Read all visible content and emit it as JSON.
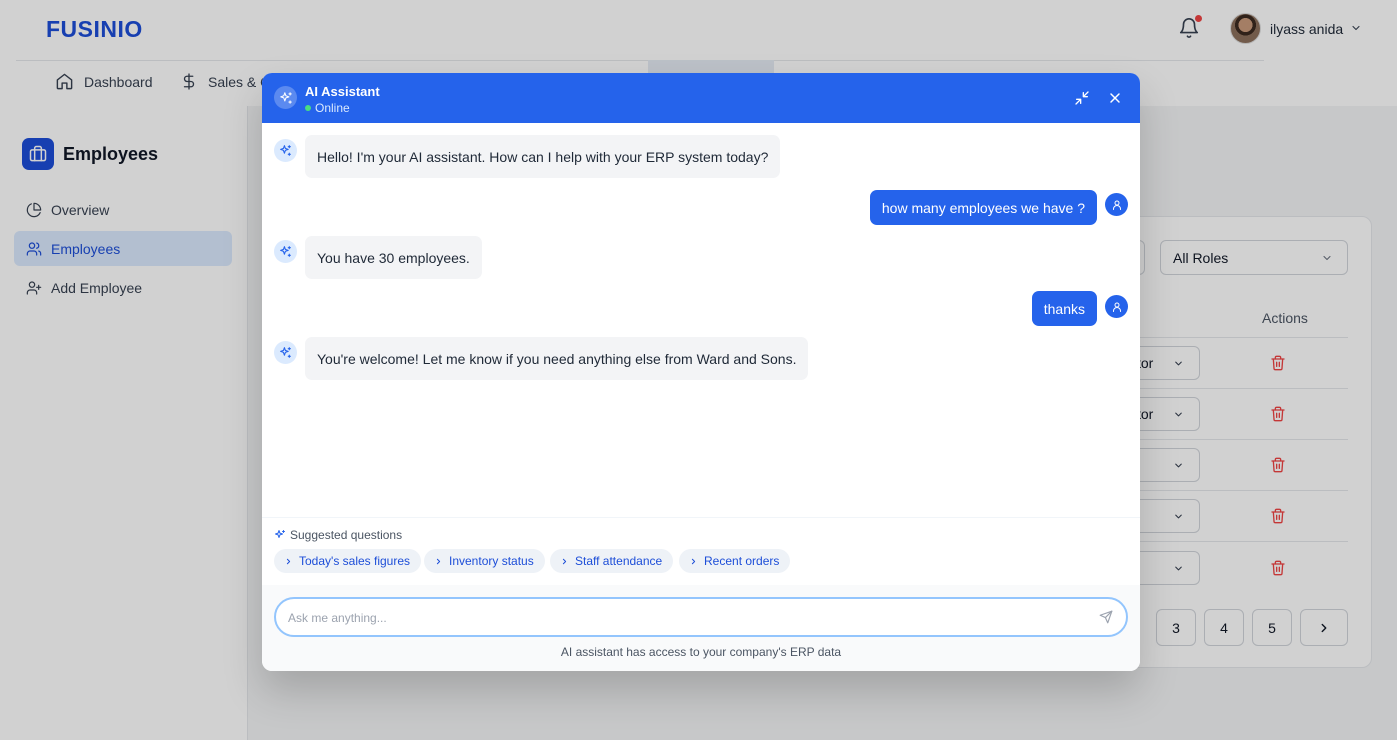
{
  "app": {
    "logo": "FUSINIO",
    "user_name": "ilyass anida"
  },
  "nav": {
    "items": [
      {
        "label": "Dashboard",
        "icon": "home-icon"
      },
      {
        "label": "Sales & O",
        "icon": "dollar-icon"
      }
    ]
  },
  "sidebar": {
    "title": "Employees",
    "items": [
      {
        "label": "Overview",
        "icon": "pie-chart-icon",
        "active": false
      },
      {
        "label": "Employees",
        "icon": "users-icon",
        "active": true
      },
      {
        "label": "Add Employee",
        "icon": "user-plus-icon",
        "active": false
      }
    ]
  },
  "background_table": {
    "role_filter": "All Roles",
    "actions_header": "Actions",
    "role_cells": [
      "tor",
      "tor",
      "",
      "",
      ""
    ],
    "pages": [
      "3",
      "4",
      "5"
    ]
  },
  "chat": {
    "title": "AI Assistant",
    "status": "Online",
    "messages": [
      {
        "from": "bot",
        "text": "Hello! I'm your AI assistant. How can I help with your ERP system today?"
      },
      {
        "from": "user",
        "text": "how many employees we have ?"
      },
      {
        "from": "bot",
        "text": "You have 30 employees."
      },
      {
        "from": "user",
        "text": "thanks"
      },
      {
        "from": "bot",
        "text": "You're welcome! Let me know if you need anything else from Ward and Sons."
      }
    ],
    "suggested_title": "Suggested questions",
    "suggestions": [
      "Today's sales figures",
      "Inventory status",
      "Staff attendance",
      "Recent orders"
    ],
    "input_placeholder": "Ask me anything...",
    "input_value": "",
    "footnote": "AI assistant has access to your company's ERP data"
  },
  "colors": {
    "brand": "#1d4ed8",
    "chat_header": "#2563eb",
    "online": "#4ade80",
    "danger": "#ef4444"
  }
}
